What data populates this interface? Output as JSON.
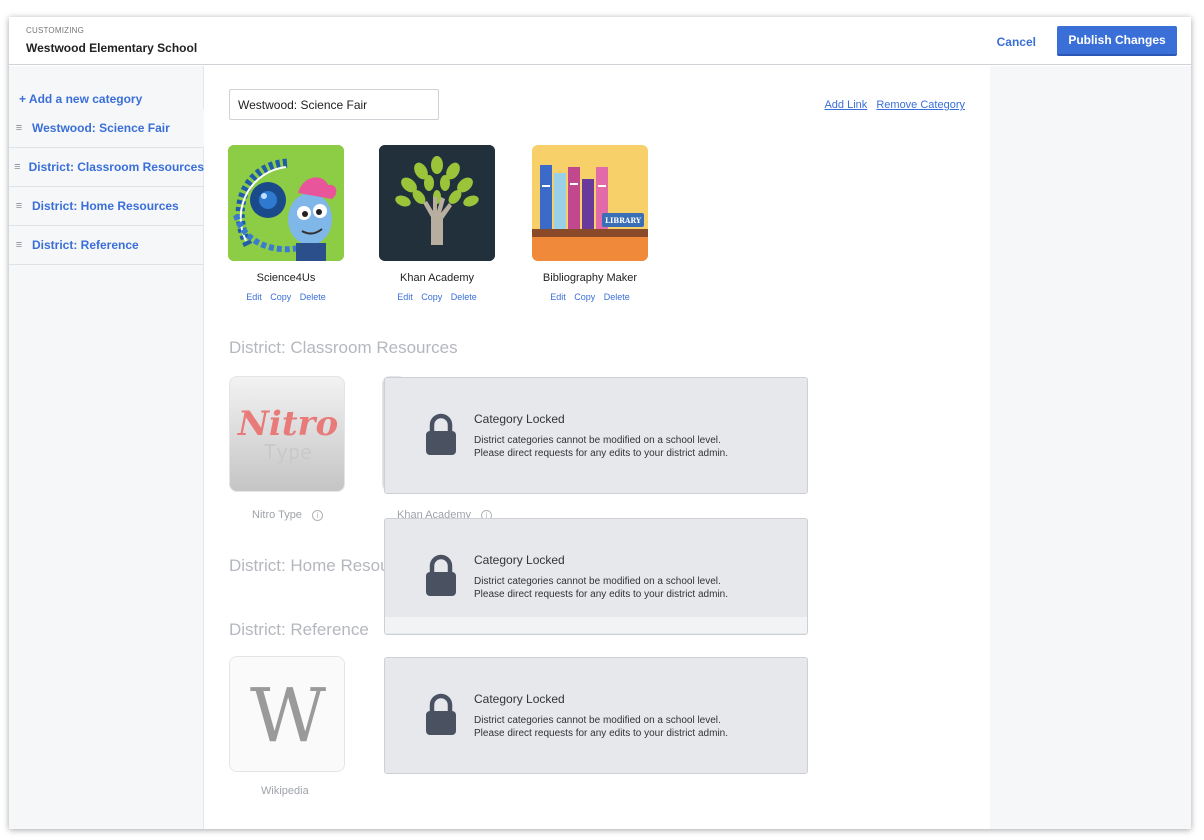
{
  "header": {
    "eyebrow": "CUSTOMIZING",
    "school": "Westwood Elementary School",
    "cancel_label": "Cancel",
    "publish_label": "Publish Changes"
  },
  "sidebar": {
    "add_label": "+ Add a new category",
    "items": [
      {
        "label": "Westwood: Science Fair"
      },
      {
        "label": "District: Classroom Resources"
      },
      {
        "label": "District: Home Resources"
      },
      {
        "label": "District: Reference"
      }
    ]
  },
  "editor": {
    "category_name": "Westwood: Science Fair",
    "add_link_label": "Add Link",
    "remove_category_label": "Remove Category",
    "tiles": [
      {
        "name": "Science4Us",
        "icon": "science4us-icon"
      },
      {
        "name": "Khan Academy",
        "icon": "khan-academy-tree-icon"
      },
      {
        "name": "Bibliography Maker",
        "icon": "library-books-icon"
      }
    ],
    "tile_actions": {
      "edit": "Edit",
      "copy": "Copy",
      "delete": "Delete"
    }
  },
  "district_sections": {
    "classroom": {
      "title": "District: Classroom Resources",
      "tiles": [
        {
          "name": "Nitro Type",
          "logo_top": "Nitro",
          "logo_bottom": "Type"
        },
        {
          "name": "Khan Academy"
        }
      ]
    },
    "home": {
      "title": "District: Home Resources"
    },
    "reference": {
      "title": "District: Reference",
      "tiles": [
        {
          "name": "Wikipedia",
          "logo": "W"
        }
      ]
    }
  },
  "lock_notice": {
    "title": "Category Locked",
    "line1": "District categories cannot be modified on a school level.",
    "line2": "Please direct requests for any edits to your district admin."
  },
  "colors": {
    "accent": "#3a6fd8",
    "lock_panel": "#e6e8ec",
    "lock_icon": "#4a5160",
    "muted_heading": "#b4b8be"
  }
}
